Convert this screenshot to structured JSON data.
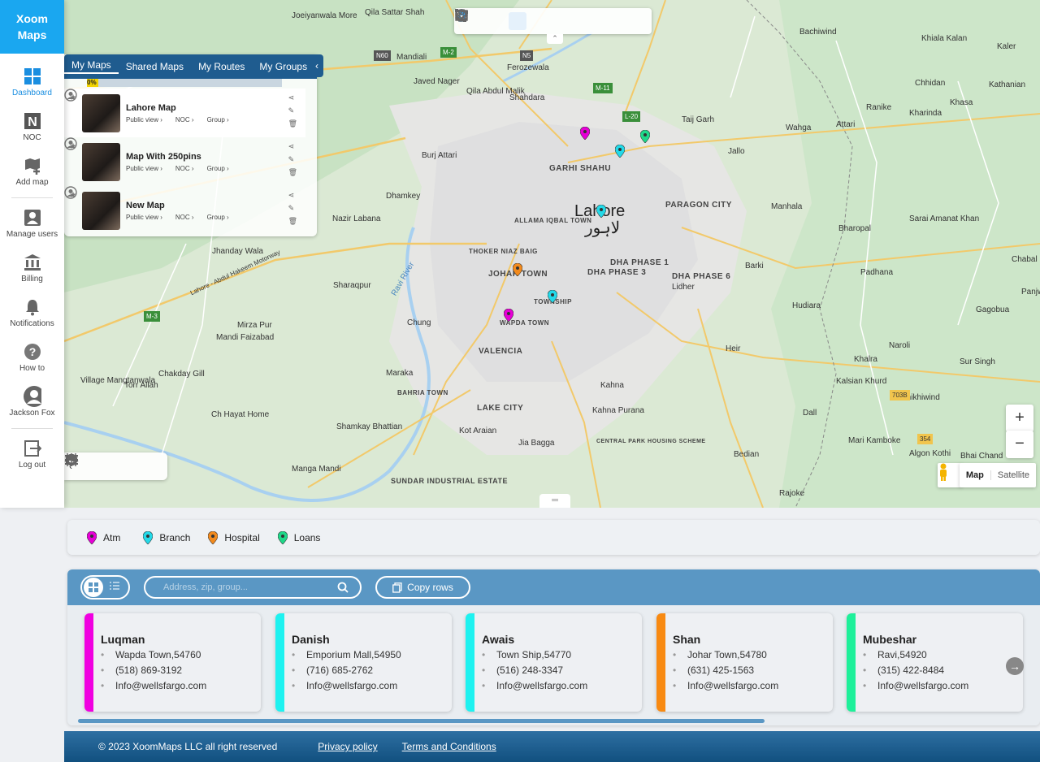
{
  "app": {
    "logo_line1": "Xoom",
    "logo_line2": "Maps"
  },
  "sidebar": {
    "items": [
      {
        "label": "Dashboard",
        "icon": "dashboard-icon"
      },
      {
        "label": "NOC",
        "icon": "noc-icon"
      },
      {
        "label": "Add map",
        "icon": "add-map-icon"
      },
      {
        "label": "Manage users",
        "icon": "manage-users-icon"
      },
      {
        "label": "Billing",
        "icon": "billing-icon"
      },
      {
        "label": "Notifications",
        "icon": "bell-icon"
      },
      {
        "label": "How to",
        "icon": "help-icon"
      },
      {
        "label": "Jackson Fox",
        "icon": "avatar-icon"
      },
      {
        "label": "Log out",
        "icon": "logout-icon"
      }
    ]
  },
  "panel": {
    "tabs": [
      "My Maps",
      "Shared Maps",
      "My Routes",
      "My Groups"
    ],
    "progress_label": "0%",
    "progress_value": 0.01,
    "maps": [
      {
        "title": "Lahore Map",
        "public": "Public view ›",
        "noc": "NOC ›",
        "group": "Group ›"
      },
      {
        "title": "Map With 250pins",
        "public": "Public view ›",
        "noc": "NOC ›",
        "group": "Group ›"
      },
      {
        "title": "New Map",
        "public": "Public view ›",
        "noc": "NOC ›",
        "group": "Group ›"
      }
    ]
  },
  "map": {
    "city": "Lahore",
    "city_urdu": "لاہور",
    "labels": [
      "Joeiyanwala More",
      "Qila Sattar Shah",
      "Mandiali",
      "Javed Nager",
      "Ferozewala",
      "Qila Abdul Malik",
      "Shahdara",
      "Taij Garh",
      "Bachiwind",
      "Khiala Kalan",
      "Kaler",
      "Chhidan",
      "Kathanian",
      "Ranike",
      "Kharinda",
      "Attari",
      "Wahga",
      "Khasa",
      "Jallo",
      "GARHI SHAHU",
      "Burj Attari",
      "Dhamkey",
      "PARAGON CITY",
      "Manhala",
      "Nazir Labana",
      "ALLAMA IQBAL TOWN",
      "Bharopal",
      "Sarai Amanat Khan",
      "Jhanday Wala",
      "THOKER NIAZ BAIG",
      "JOHAR TOWN",
      "DHA PHASE 1",
      "DHA PHASE 3",
      "DHA PHASE 6",
      "Lidher",
      "Barki",
      "Padhana",
      "Chabal Kalan",
      "Sharaqpur",
      "TOWNSHIP",
      "Hudiara",
      "Gagobua",
      "Panjwar",
      "Mirza Pur",
      "Chung",
      "WAPDA TOWN",
      "Mandi Faizabad",
      "VALENCIA",
      "Heir",
      "Khalra",
      "Naroli",
      "Sur Singh",
      "Village Mangtanwala",
      "Chakday Gill",
      "Maraka",
      "Torr Allah",
      "BAHRIA TOWN",
      "Kalsian Khurd",
      "Kahna",
      "LAKE CITY",
      "Kahna Purana",
      "Bhikhiwind",
      "Ch Hayat Home",
      "Shamkay Bhattian",
      "Kot Araian",
      "Dall",
      "Jia Bagga",
      "CENTRAL PARK HOUSING SCHEME",
      "Mari Kamboke",
      "Algon Kothi",
      "Manga Mandi",
      "SUNDAR INDUSTRIAL ESTATE",
      "Bedian",
      "Bhai Chand",
      "Rajoke"
    ],
    "roads": [
      "M-2",
      "N60",
      "N5",
      "M-11",
      "L-20",
      "M-3",
      "703B",
      "354"
    ],
    "river": "Ravi River",
    "motorway": "Lahore - Abdul Hakeem Motorway",
    "zoom_in": "+",
    "zoom_out": "−",
    "map_type": [
      "Map",
      "Satellite"
    ]
  },
  "legend": [
    {
      "label": "Atm",
      "color": "#e600d6"
    },
    {
      "label": "Branch",
      "color": "#23d9e8"
    },
    {
      "label": "Hospital",
      "color": "#f28a1d"
    },
    {
      "label": "Loans",
      "color": "#1ed889"
    }
  ],
  "data_section": {
    "search_placeholder": "Address, zip, group...",
    "copy_label": "Copy rows",
    "cards": [
      {
        "name": "Luqman",
        "address": "Wapda Town,54760",
        "phone": "(518) 869-3192",
        "email": "Info@wellsfargo.com",
        "color": "#f000e0"
      },
      {
        "name": "Danish",
        "address": "Emporium Mall,54950",
        "phone": "(716) 685-2762",
        "email": "Info@wellsfargo.com",
        "color": "#1ef2f0"
      },
      {
        "name": "Awais",
        "address": "Town Ship,54770",
        "phone": "(516) 248-3347",
        "email": "Info@wellsfargo.com",
        "color": "#1ef2f0"
      },
      {
        "name": "Shan",
        "address": "Johar Town,54780",
        "phone": "(631) 425-1563",
        "email": "Info@wellsfargo.com",
        "color": "#f88a12"
      },
      {
        "name": "Mubeshar",
        "address": "Ravi,54920",
        "phone": "(315) 422-8484",
        "email": "Info@wellsfargo.com",
        "color": "#1ef09a"
      }
    ]
  },
  "footer": {
    "copyright": "© 2023 XoomMaps LLC all right reserved",
    "privacy": "Privacy policy",
    "terms": "Terms and Conditions"
  }
}
